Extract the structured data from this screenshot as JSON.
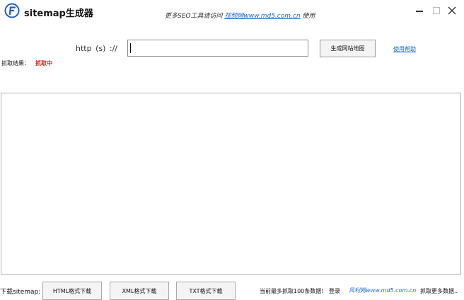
{
  "titlebar": {
    "app_title": "sitemap生成器",
    "promo_prefix": "更多SEO工具请访问",
    "promo_link": "视频网www.md5.com.cn",
    "promo_suffix": "使用"
  },
  "form": {
    "url_label": "http (s) ://",
    "url_value": "",
    "generate_label": "生成网站地图",
    "help_label": "使用帮助",
    "result_label": "抓取结果：",
    "result_status": "抓取中"
  },
  "results": [],
  "footer": {
    "download_label": "下载sitemap:",
    "html_label": "HTML格式下载",
    "xml_label": "XML格式下载",
    "txt_label": "TXT格式下载",
    "limit_text": "当前最多抓取100条数据!",
    "login_label": "登录",
    "site_link": "风利网www.md5.com.cn",
    "more_text": "抓取更多数据.."
  },
  "colors": {
    "link": "#1a66cc",
    "status": "#e02020",
    "logo": "#1f5fbf"
  },
  "icons": [
    "app-logo-icon",
    "minimize-icon",
    "maximize-icon",
    "close-icon"
  ]
}
